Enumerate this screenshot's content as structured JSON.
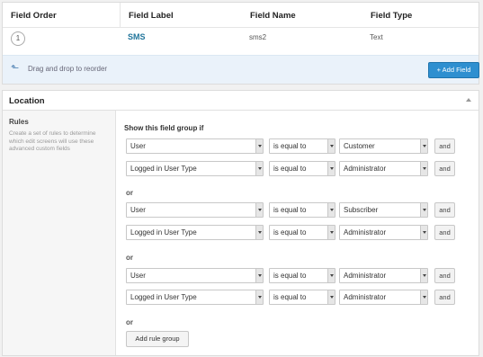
{
  "fields_table": {
    "headers": {
      "order": "Field Order",
      "label": "Field Label",
      "name": "Field Name",
      "type": "Field Type"
    },
    "rows": [
      {
        "order": "1",
        "label": "SMS",
        "name": "sms2",
        "type": "Text"
      }
    ],
    "drag_hint": "Drag and drop to reorder",
    "add_field_label": "+ Add Field"
  },
  "location": {
    "title": "Location",
    "rules_title": "Rules",
    "rules_description": "Create a set of rules to determine which edit screens will use these advanced custom fields",
    "show_if_label": "Show this field group if",
    "or_label": "or",
    "and_label": "and",
    "add_rule_group_label": "Add rule group",
    "groups": [
      {
        "rules": [
          {
            "param": "User",
            "operator": "is equal to",
            "value": "Customer"
          },
          {
            "param": "Logged in User Type",
            "operator": "is equal to",
            "value": "Administrator"
          }
        ]
      },
      {
        "rules": [
          {
            "param": "User",
            "operator": "is equal to",
            "value": "Subscriber"
          },
          {
            "param": "Logged in User Type",
            "operator": "is equal to",
            "value": "Administrator"
          }
        ]
      },
      {
        "rules": [
          {
            "param": "User",
            "operator": "is equal to",
            "value": "Administrator"
          },
          {
            "param": "Logged in User Type",
            "operator": "is equal to",
            "value": "Administrator"
          }
        ]
      }
    ]
  },
  "colors": {
    "link": "#21759b",
    "primary_button": "#2e8fd0",
    "footer_bg": "#eaf2fa"
  }
}
